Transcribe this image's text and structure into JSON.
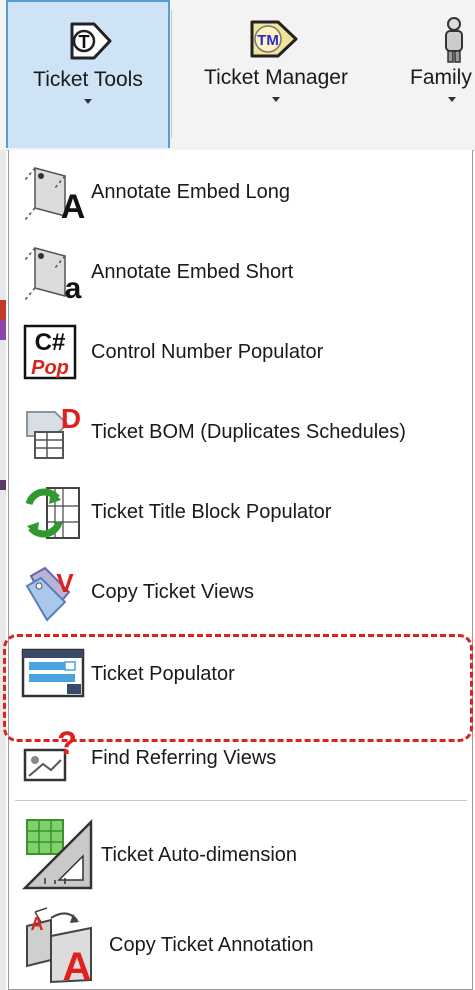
{
  "ribbon": {
    "buttons": [
      {
        "label": "Ticket Tools",
        "icon": "ticket-t-icon",
        "active": true
      },
      {
        "label": "Ticket Manager",
        "icon": "ticket-tm-icon",
        "active": false
      },
      {
        "label": "Family",
        "icon": "family-icon",
        "active": false
      }
    ]
  },
  "menu": {
    "items": [
      {
        "label": "Annotate Embed Long",
        "icon": "annotate-embed-long-icon"
      },
      {
        "label": "Annotate Embed Short",
        "icon": "annotate-embed-short-icon"
      },
      {
        "label": "Control Number Populator",
        "icon": "control-number-populator-icon",
        "icon_text": "C#",
        "icon_subtext": "Pop"
      },
      {
        "label": "Ticket BOM (Duplicates Schedules)",
        "icon": "ticket-bom-icon",
        "icon_text": "D"
      },
      {
        "label": "Ticket Title Block Populator",
        "icon": "title-block-populator-icon"
      },
      {
        "label": "Copy Ticket Views",
        "icon": "copy-ticket-views-icon",
        "icon_text": "V"
      },
      {
        "label": "Ticket Populator",
        "icon": "ticket-populator-icon",
        "highlighted": true
      },
      {
        "label": "Find Referring Views",
        "icon": "find-referring-views-icon",
        "icon_text": "?"
      },
      {
        "label": "Ticket Auto-dimension",
        "icon": "ticket-auto-dimension-icon"
      },
      {
        "label": "Copy Ticket Annotation",
        "icon": "copy-ticket-annotation-icon",
        "icon_text": "A"
      }
    ]
  },
  "icon_text": {
    "ticket_t": "T",
    "ticket_tm": "TM",
    "annot_long": "A",
    "annot_short": "a",
    "copy_annot_small": "A"
  },
  "colors": {
    "highlight": "#e01f1f",
    "active_button_bg": "#cfe3f6",
    "active_button_border": "#5b9bd5"
  }
}
